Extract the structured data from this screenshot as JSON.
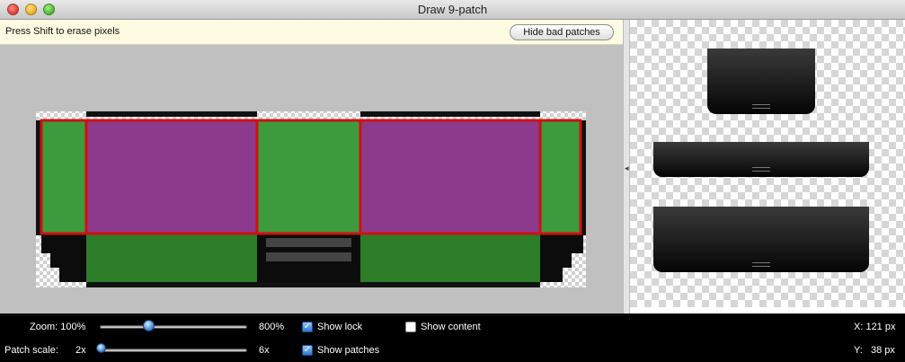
{
  "window": {
    "title": "Draw 9-patch"
  },
  "infobar": {
    "hint": "Press Shift to erase pixels",
    "hide_bad_patches": "Hide bad patches"
  },
  "controls": {
    "zoom_label": "Zoom: 100%",
    "zoom_max": "800%",
    "zoom_level": 0.06,
    "patch_scale_label": "Patch scale:",
    "patch_scale_min": "2x",
    "patch_scale_max": "6x",
    "patch_scale_level": 0.0,
    "show_lock": {
      "label": "Show lock",
      "checked": true
    },
    "show_patches": {
      "label": "Show patches",
      "checked": true
    },
    "show_content": {
      "label": "Show content",
      "checked": false
    },
    "x_readout": "X: 121 px",
    "y_readout": "Y:   38 px"
  },
  "colors": {
    "patch_green": "#3d9a3d",
    "patch_purple": "#8d3a8d",
    "bad_patch_red": "#d01010",
    "dark_green": "#2e7d29",
    "slider_blue": "#4a8fd6"
  }
}
